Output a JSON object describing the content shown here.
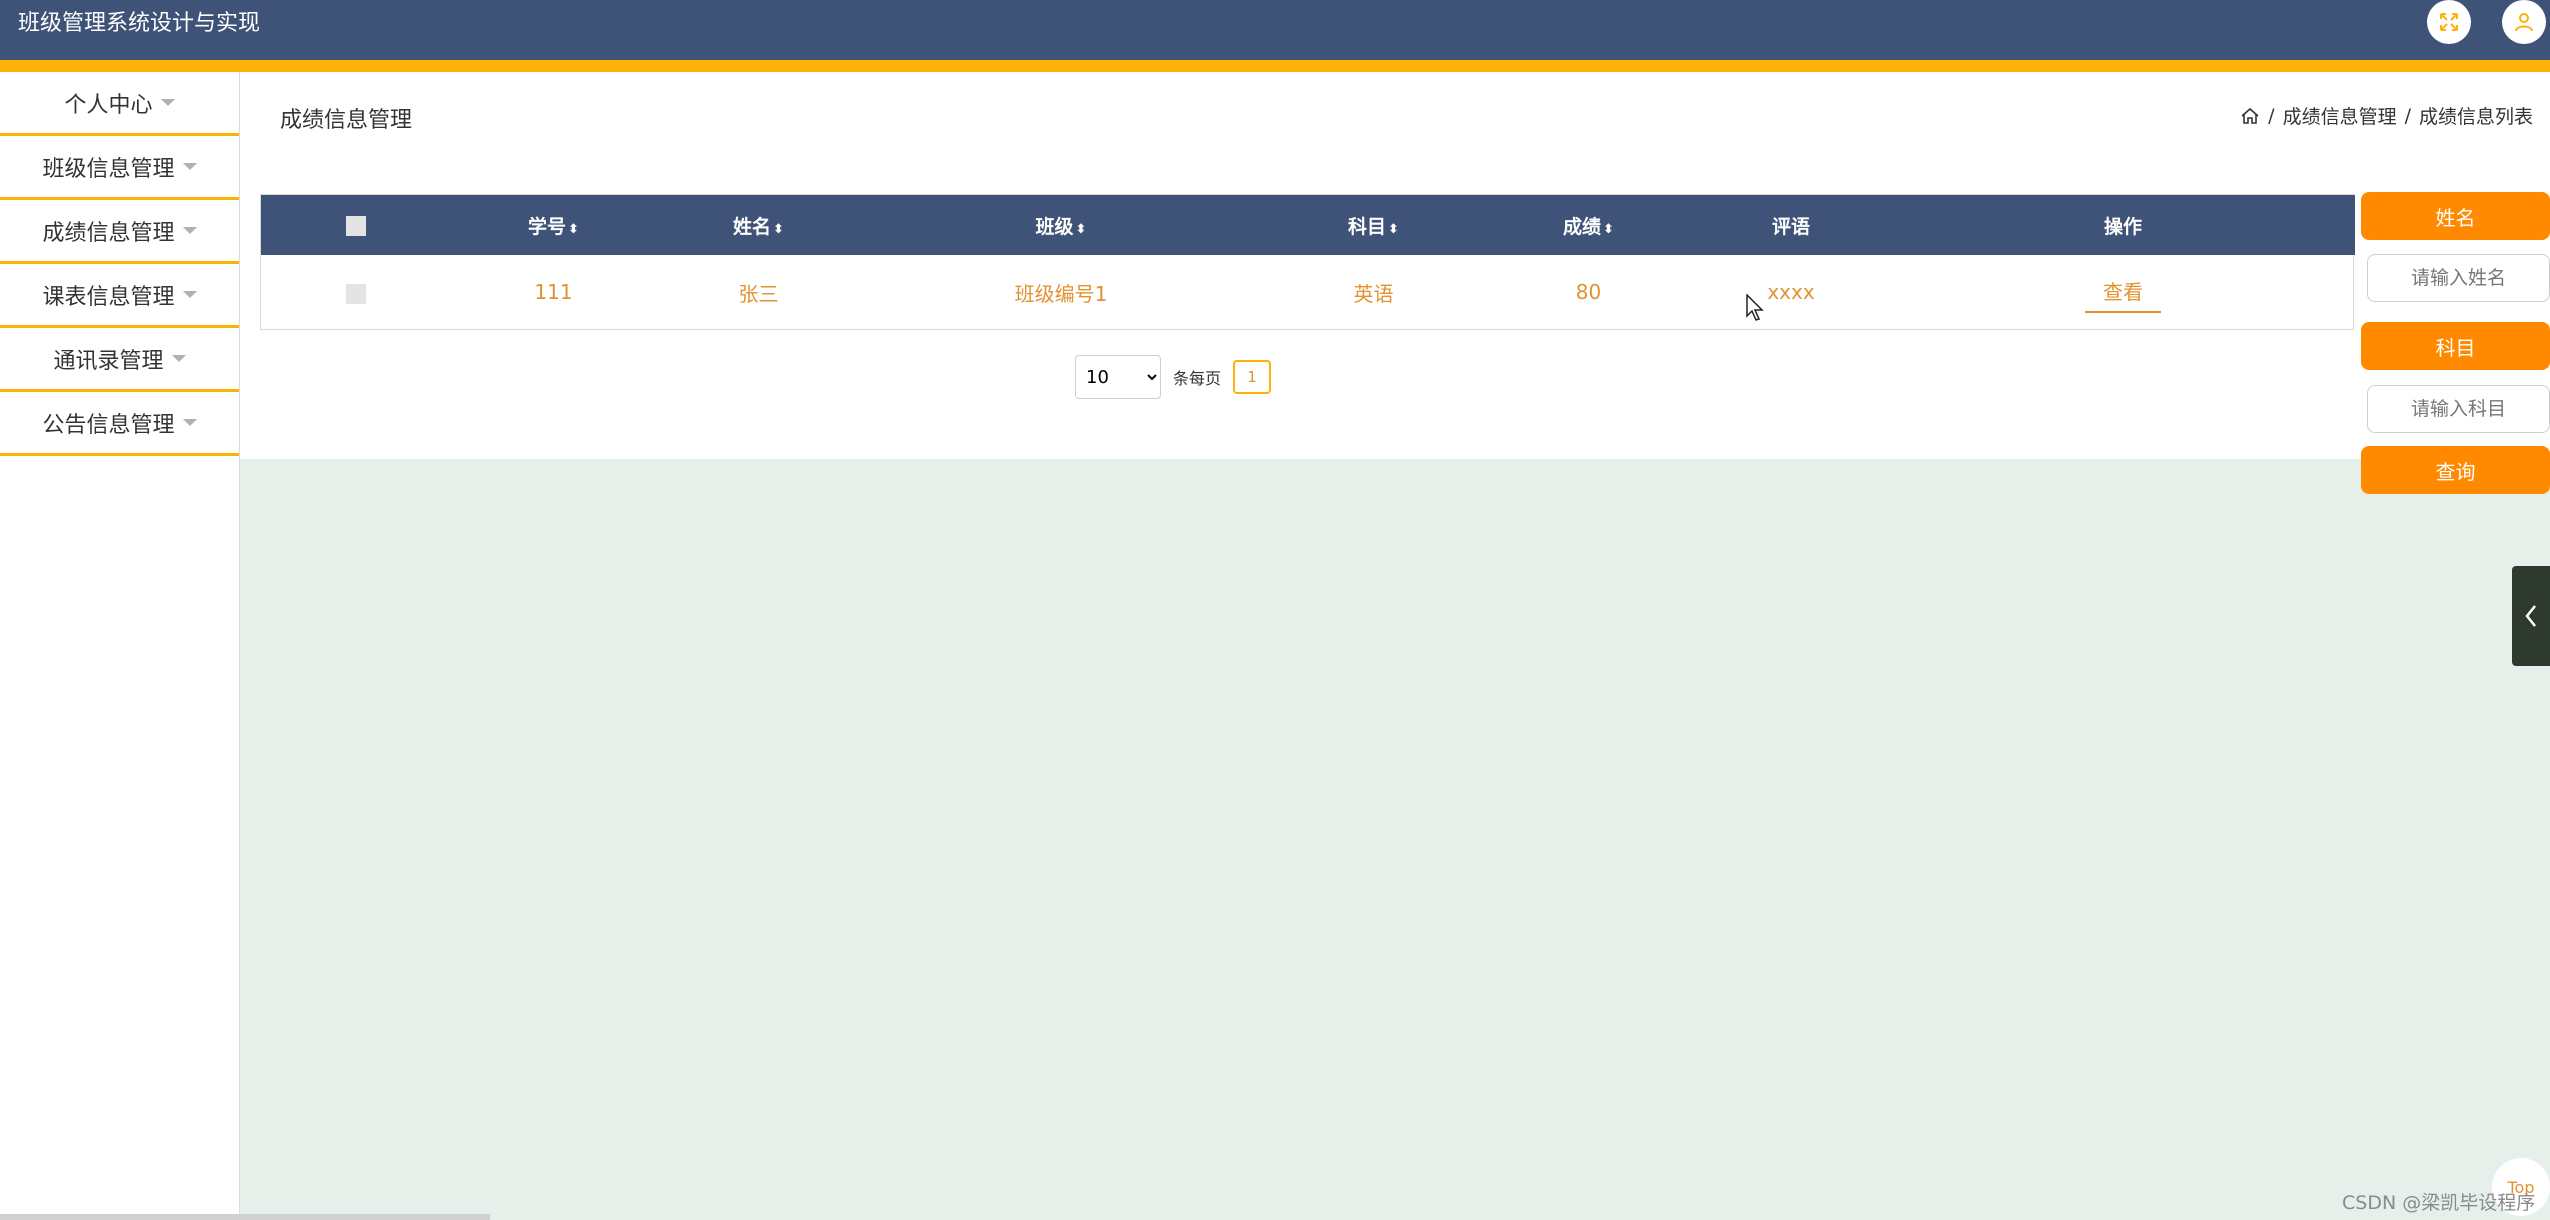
{
  "header": {
    "title": "班级管理系统设计与实现"
  },
  "sidebar": {
    "items": [
      {
        "label": "个人中心"
      },
      {
        "label": "班级信息管理"
      },
      {
        "label": "成绩信息管理"
      },
      {
        "label": "课表信息管理"
      },
      {
        "label": "通讯录管理"
      },
      {
        "label": "公告信息管理"
      }
    ]
  },
  "main": {
    "page_title": "成绩信息管理",
    "breadcrumb": {
      "sep": "/",
      "items": [
        "成绩信息管理",
        "成绩信息列表"
      ]
    },
    "table": {
      "columns": [
        "学号",
        "姓名",
        "班级",
        "科目",
        "成绩",
        "评语",
        "操作"
      ],
      "sort_icon": "⬍",
      "rows": [
        {
          "id": "111",
          "name": "张三",
          "class": "班级编号1",
          "subject": "英语",
          "score": "80",
          "comment": "xxxx",
          "action": "查看"
        }
      ]
    },
    "pager": {
      "page_size": "10",
      "page_size_options": [
        "10"
      ],
      "per_page_label": "条每页",
      "current_page": "1"
    }
  },
  "search": {
    "name_label": "姓名",
    "name_placeholder": "请输入姓名",
    "subject_label": "科目",
    "subject_placeholder": "请输入科目",
    "query_button": "查询"
  },
  "footer": {
    "top_label": "Top",
    "watermark": "CSDN @梁凯毕设程序"
  },
  "colors": {
    "header": "#3f5278",
    "accent": "#fbb30a",
    "button": "#ff8a00",
    "link": "#e2932f",
    "background": "#e6efe9"
  }
}
